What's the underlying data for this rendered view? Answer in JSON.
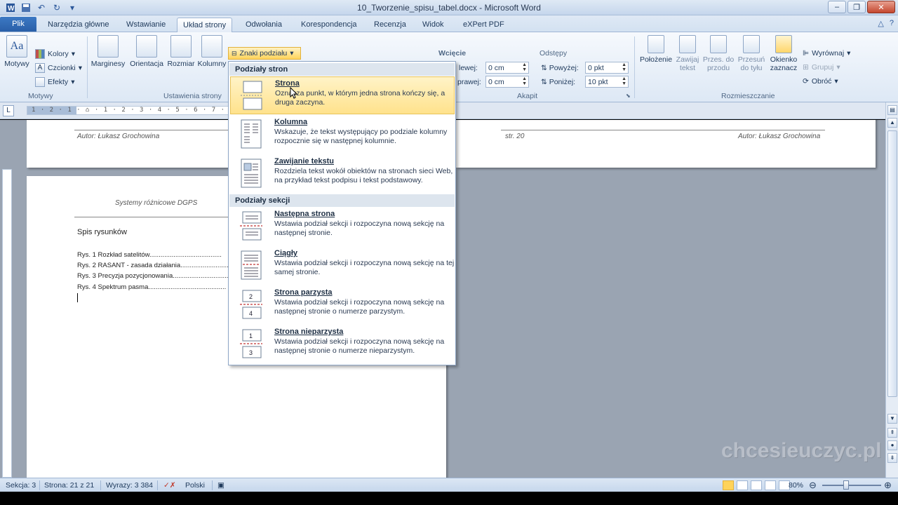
{
  "window": {
    "title": "10_Tworzenie_spisu_tabel.docx - Microsoft Word",
    "qat_icons": [
      "word-icon",
      "save-icon",
      "undo-icon",
      "redo-icon",
      "customize-icon"
    ],
    "buttons": [
      "minimize",
      "maximize",
      "close"
    ]
  },
  "tabs": [
    {
      "label": "Plik"
    },
    {
      "label": "Narzędzia główne"
    },
    {
      "label": "Wstawianie"
    },
    {
      "label": "Układ strony"
    },
    {
      "label": "Odwołania"
    },
    {
      "label": "Korespondencja"
    },
    {
      "label": "Recenzja"
    },
    {
      "label": "Widok"
    },
    {
      "label": "eXPert PDF"
    }
  ],
  "ribbon": {
    "motywy": {
      "big": "Motywy",
      "kolory": "Kolory",
      "czcionki": "Czcionki",
      "efekty": "Efekty",
      "group": "Motywy"
    },
    "ustawienia": {
      "marginesy": "Marginesy",
      "orientacja": "Orientacja",
      "rozmiar": "Rozmiar",
      "kolumny": "Kolumny",
      "znaki": "Znaki podziału",
      "group": "Ustawienia strony"
    },
    "akapit": {
      "wciecie": "Wcięcie",
      "lewej_label": "lewej:",
      "lewej_value": "0 cm",
      "prawej_label": "prawej:",
      "prawej_value": "0 cm",
      "odstepy": "Odstępy",
      "powyzej_label": "Powyżej:",
      "powyzej_value": "0 pkt",
      "ponizej_label": "Poniżej:",
      "ponizej_value": "10 pkt",
      "group": "Akapit"
    },
    "rozmieszczanie": {
      "polozenie": "Położenie",
      "zawijaj": "Zawijaj tekst",
      "przes_do_przodu": "Przes. do przodu",
      "przesun_do_tylu": "Przesuń do tyłu",
      "okienko": "Okienko zaznacz",
      "wyrownaj": "Wyrównaj",
      "grupuj": "Grupuj",
      "obroc": "Obróć",
      "group": "Rozmieszczanie"
    }
  },
  "ruler": {
    "text": "1 · 2 · 1 · ⌂ · 1 · 2 · 3 · 4 · 5 · 6 · 7 · 8 · 9"
  },
  "document": {
    "page1_header_left": "Autor: Łukasz Grochowina",
    "page2_header_page": "str. 20",
    "page2_header_right": "Autor: Łukasz Grochowina",
    "page3_header": "Systemy różnicowe DGPS",
    "heading": "Spis rysunków",
    "toc": [
      "Rys. 1 Rozkład satelitów.......................................",
      "Rys. 2 RASANT - zasada działania.............................",
      "Rys. 3 Precyzja pozycjonowania...............................",
      "Rys. 4 Spektrum pasma.........................................."
    ],
    "watermark": "chcesieuczyc.pl"
  },
  "menu": {
    "section1": "Podziały stron",
    "section2": "Podziały sekcji",
    "items": [
      {
        "title": "Strona",
        "desc": "Oznacza punkt, w którym jedna strona kończy się, a druga zaczyna."
      },
      {
        "title": "Kolumna",
        "desc": "Wskazuje, że tekst występujący po podziale kolumny rozpocznie się w następnej kolumnie."
      },
      {
        "title": "Zawijanie tekstu",
        "desc": "Rozdziela tekst wokół obiektów na stronach sieci Web, na przykład tekst podpisu i tekst podstawowy."
      },
      {
        "title": "Następna strona",
        "desc": "Wstawia podział sekcji i rozpoczyna nową sekcję na następnej stronie."
      },
      {
        "title": "Ciągły",
        "desc": "Wstawia podział sekcji i rozpoczyna nową sekcję na tej samej stronie."
      },
      {
        "title": "Strona parzysta",
        "desc": "Wstawia podział sekcji i rozpoczyna nową sekcję na następnej stronie o numerze parzystym."
      },
      {
        "title": "Strona nieparzysta",
        "desc": "Wstawia podział sekcji i rozpoczyna nową sekcję na następnej stronie o numerze nieparzystym."
      }
    ]
  },
  "status": {
    "sekcja": "Sekcja: 3",
    "strona": "Strona: 21 z 21",
    "wyrazy": "Wyrazy: 3 384",
    "jezyk": "Polski",
    "zoom": "80%"
  },
  "colors": {
    "accent": "#2b579a",
    "highlight": "#ffe28c",
    "file_tab": "#2a5fa8"
  }
}
